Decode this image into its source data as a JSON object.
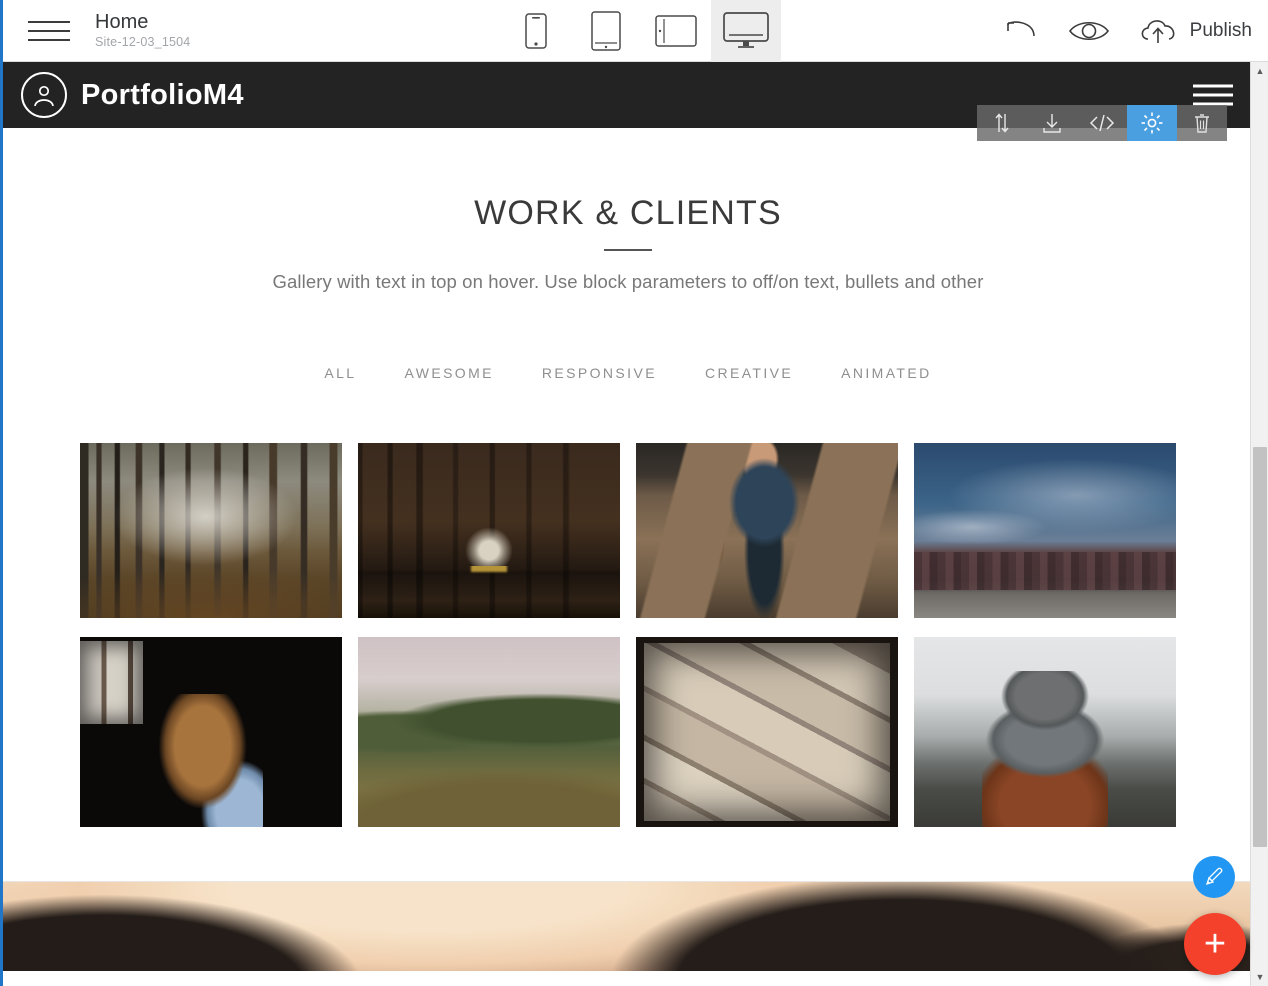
{
  "editor": {
    "menu_icon": "hamburger-icon",
    "page_title": "Home",
    "site_id": "Site-12-03_1504",
    "devices": [
      {
        "name": "mobile",
        "icon": "phone-icon",
        "active": false
      },
      {
        "name": "tablet",
        "icon": "tablet-portrait-icon",
        "active": false
      },
      {
        "name": "landscape",
        "icon": "tablet-landscape-icon",
        "active": false
      },
      {
        "name": "desktop",
        "icon": "desktop-icon",
        "active": true
      }
    ],
    "tools": [
      {
        "name": "undo",
        "icon": "undo-icon"
      },
      {
        "name": "preview",
        "icon": "eye-icon"
      }
    ],
    "publish_label": "Publish",
    "publish_icon": "cloud-upload-icon"
  },
  "block_toolbar": {
    "items": [
      {
        "name": "move",
        "icon": "move-up-down-icon",
        "selected": false
      },
      {
        "name": "download",
        "icon": "download-icon",
        "selected": false
      },
      {
        "name": "code",
        "icon": "code-icon",
        "selected": false,
        "label": "</>"
      },
      {
        "name": "settings",
        "icon": "gear-icon",
        "selected": true
      },
      {
        "name": "delete",
        "icon": "trash-icon",
        "selected": false
      }
    ],
    "selected_color": "#4a9fe0"
  },
  "site": {
    "navbar": {
      "brand_name": "PortfolioM4",
      "brand_icon": "user-circle-icon",
      "menu_icon": "hamburger-icon",
      "bg_color": "#232323"
    },
    "gallery": {
      "title": "WORK & CLIENTS",
      "subtitle": "Gallery with text in top on hover. Use block parameters to off/on text, bullets and other",
      "filters": [
        {
          "label": "ALL",
          "active": true
        },
        {
          "label": "AWESOME",
          "active": false
        },
        {
          "label": "RESPONSIVE",
          "active": false
        },
        {
          "label": "CREATIVE",
          "active": false
        },
        {
          "label": "ANIMATED",
          "active": false
        }
      ],
      "items": [
        {
          "name": "autumn-forest",
          "style": "ph-forest",
          "tall": false
        },
        {
          "name": "model-ship-shelf",
          "style": "ph-ship",
          "tall": false
        },
        {
          "name": "man-tweed-blazer",
          "style": "ph-suit",
          "tall": false
        },
        {
          "name": "night-sky-treeline",
          "style": "ph-nightsky",
          "tall": false
        },
        {
          "name": "woman-dark-room",
          "style": "ph-darkwoman",
          "tall": true
        },
        {
          "name": "green-hills",
          "style": "ph-hills",
          "tall": true
        },
        {
          "name": "vintage-paper-maps",
          "style": "ph-maps",
          "tall": true
        },
        {
          "name": "person-fog-beanie",
          "style": "ph-fog",
          "tall": true
        }
      ]
    },
    "next_block": {
      "name": "sunset-mountains",
      "style": "ph-sunset"
    }
  },
  "fabs": {
    "brush": {
      "name": "brush-icon",
      "color": "#2196f3"
    },
    "add": {
      "name": "plus-icon",
      "color": "#f4412c",
      "label": "+"
    }
  },
  "scrollbar": {
    "up": "▲",
    "down": "▼"
  }
}
